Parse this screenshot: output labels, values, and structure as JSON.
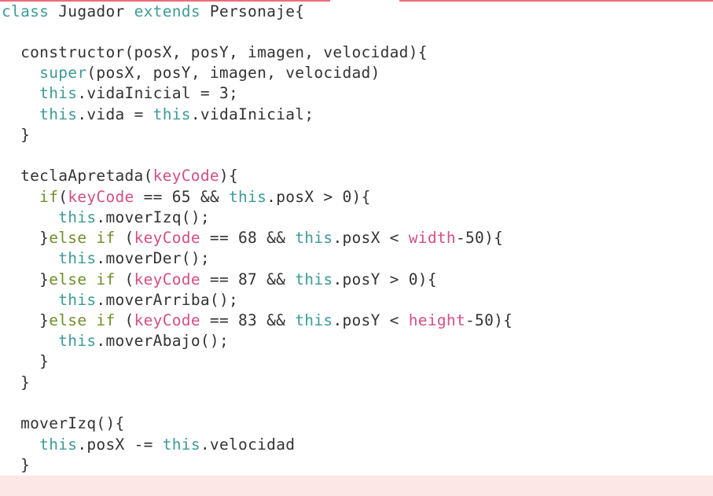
{
  "editor": {
    "lines": [
      [
        {
          "t": "class",
          "c": "kw"
        },
        {
          "t": " Jugador ",
          "c": "plain"
        },
        {
          "t": "extends",
          "c": "kw"
        },
        {
          "t": " Personaje{",
          "c": "plain"
        }
      ],
      [],
      [
        {
          "t": "  constructor(posX, posY, imagen, velocidad){",
          "c": "plain"
        }
      ],
      [
        {
          "t": "    ",
          "c": "plain"
        },
        {
          "t": "super",
          "c": "super"
        },
        {
          "t": "(posX, posY, imagen, velocidad)",
          "c": "plain"
        }
      ],
      [
        {
          "t": "    ",
          "c": "plain"
        },
        {
          "t": "this",
          "c": "this"
        },
        {
          "t": ".vidaInicial = 3;",
          "c": "plain"
        }
      ],
      [
        {
          "t": "    ",
          "c": "plain"
        },
        {
          "t": "this",
          "c": "this"
        },
        {
          "t": ".vida = ",
          "c": "plain"
        },
        {
          "t": "this",
          "c": "this"
        },
        {
          "t": ".vidaInicial;",
          "c": "plain"
        }
      ],
      [
        {
          "t": "  }",
          "c": "plain"
        }
      ],
      [],
      [
        {
          "t": "  teclaApretada(",
          "c": "plain"
        },
        {
          "t": "keyCode",
          "c": "pink"
        },
        {
          "t": "){",
          "c": "plain"
        }
      ],
      [
        {
          "t": "    ",
          "c": "plain"
        },
        {
          "t": "if",
          "c": "if"
        },
        {
          "t": "(",
          "c": "plain"
        },
        {
          "t": "keyCode",
          "c": "pink"
        },
        {
          "t": " == 65 && ",
          "c": "plain"
        },
        {
          "t": "this",
          "c": "this"
        },
        {
          "t": ".posX > 0){",
          "c": "plain"
        }
      ],
      [
        {
          "t": "      ",
          "c": "plain"
        },
        {
          "t": "this",
          "c": "this"
        },
        {
          "t": ".moverIzq();",
          "c": "plain"
        }
      ],
      [
        {
          "t": "    }",
          "c": "plain"
        },
        {
          "t": "else if",
          "c": "if"
        },
        {
          "t": " (",
          "c": "plain"
        },
        {
          "t": "keyCode",
          "c": "pink"
        },
        {
          "t": " == 68 && ",
          "c": "plain"
        },
        {
          "t": "this",
          "c": "this"
        },
        {
          "t": ".posX < ",
          "c": "plain"
        },
        {
          "t": "width",
          "c": "pink"
        },
        {
          "t": "-50){",
          "c": "plain"
        }
      ],
      [
        {
          "t": "      ",
          "c": "plain"
        },
        {
          "t": "this",
          "c": "this"
        },
        {
          "t": ".moverDer();",
          "c": "plain"
        }
      ],
      [
        {
          "t": "    }",
          "c": "plain"
        },
        {
          "t": "else if",
          "c": "if"
        },
        {
          "t": " (",
          "c": "plain"
        },
        {
          "t": "keyCode",
          "c": "pink"
        },
        {
          "t": " == 87 && ",
          "c": "plain"
        },
        {
          "t": "this",
          "c": "this"
        },
        {
          "t": ".posY > 0){",
          "c": "plain"
        }
      ],
      [
        {
          "t": "      ",
          "c": "plain"
        },
        {
          "t": "this",
          "c": "this"
        },
        {
          "t": ".moverArriba();",
          "c": "plain"
        }
      ],
      [
        {
          "t": "    }",
          "c": "plain"
        },
        {
          "t": "else if",
          "c": "if"
        },
        {
          "t": " (",
          "c": "plain"
        },
        {
          "t": "keyCode",
          "c": "pink"
        },
        {
          "t": " == 83 && ",
          "c": "plain"
        },
        {
          "t": "this",
          "c": "this"
        },
        {
          "t": ".posY < ",
          "c": "plain"
        },
        {
          "t": "height",
          "c": "pink"
        },
        {
          "t": "-50){",
          "c": "plain"
        }
      ],
      [
        {
          "t": "      ",
          "c": "plain"
        },
        {
          "t": "this",
          "c": "this"
        },
        {
          "t": ".moverAbajo();",
          "c": "plain"
        }
      ],
      [
        {
          "t": "    }",
          "c": "plain"
        }
      ],
      [
        {
          "t": "  }",
          "c": "plain"
        }
      ],
      [],
      [
        {
          "t": "  moverIzq(){",
          "c": "plain"
        }
      ],
      [
        {
          "t": "    ",
          "c": "plain"
        },
        {
          "t": "this",
          "c": "this"
        },
        {
          "t": ".posX -= ",
          "c": "plain"
        },
        {
          "t": "this",
          "c": "this"
        },
        {
          "t": ".velocidad",
          "c": "plain"
        }
      ],
      [
        {
          "t": "  }",
          "c": "plain"
        }
      ]
    ],
    "colors": {
      "keyword": "#3d9b96",
      "control": "#6f8f2b",
      "param": "#d44f83",
      "text": "#333333",
      "accent_bar": "#ef6b7d",
      "current_line_bg": "#fde6e6"
    }
  }
}
